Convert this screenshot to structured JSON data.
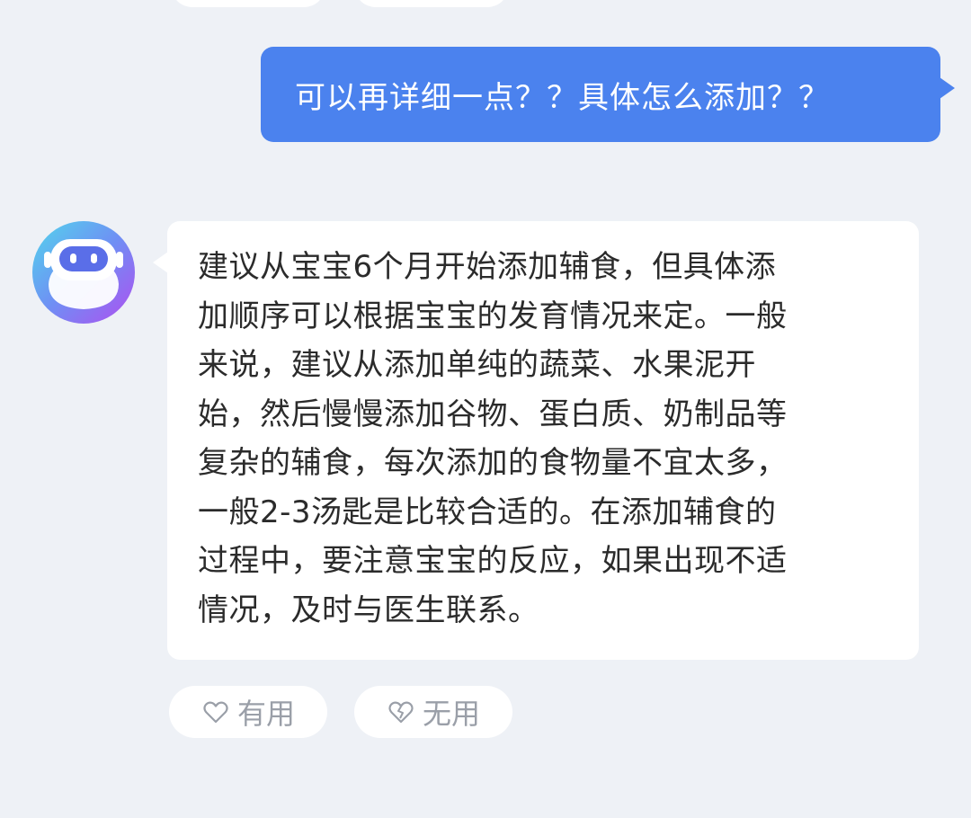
{
  "user_message": {
    "text": "可以再详细一点？？具体怎么添加？？"
  },
  "bot_message": {
    "text": "建议从宝宝6个月开始添加辅食，但具体添\n加顺序可以根据宝宝的发育情况来定。一般\n来说，建议从添加单纯的蔬菜、水果泥开\n始，然后慢慢添加谷物、蛋白质、奶制品等\n复杂的辅食，每次添加的食物量不宜太多，\n一般2-3汤匙是比较合适的。在添加辅食的\n过程中，要注意宝宝的反应，如果出现不适\n情况，及时与医生联系。"
  },
  "feedback": {
    "useful_label": "有用",
    "useful_icon": "heart-icon",
    "useless_label": "无用",
    "useless_icon": "broken-heart-icon"
  },
  "avatar": {
    "icon": "robot-icon"
  },
  "colors": {
    "background": "#eef1f6",
    "user_bubble": "#4b82ee",
    "bot_bubble": "#ffffff",
    "feedback_text": "#9a9fa8"
  }
}
